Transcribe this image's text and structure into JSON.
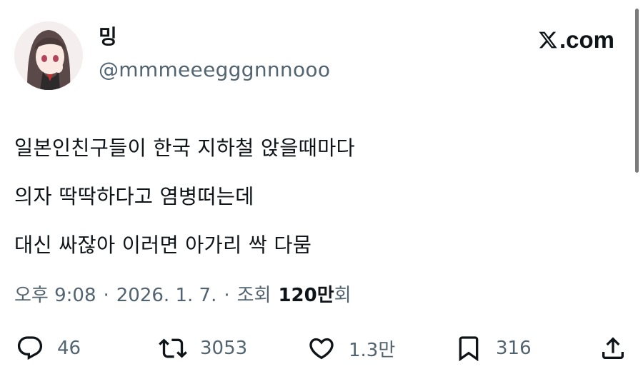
{
  "author": {
    "display_name": "밍",
    "handle": "@mmmeeegggnnnooo",
    "avatar_icon": "anime-girl-avatar"
  },
  "brand": {
    "label": ".com",
    "logo_icon": "x-logo-icon"
  },
  "tweet": {
    "lines": [
      "일본인친구들이 한국 지하철 앉을때마다",
      "의자 딱딱하다고 염병떠는데",
      "대신 싸잖아 이러면 아가리 싹 다뭄"
    ]
  },
  "meta": {
    "time": "오후 9:08",
    "sep1": "·",
    "date": "2026. 1. 7.",
    "sep2": "·",
    "views_label": "조회",
    "views_count": "120만",
    "views_unit": "회"
  },
  "actions": {
    "reply": {
      "icon": "reply-icon",
      "count": "46"
    },
    "repost": {
      "icon": "repost-icon",
      "count": "3053"
    },
    "like": {
      "icon": "heart-icon",
      "count": "1.3만"
    },
    "bookmark": {
      "icon": "bookmark-icon",
      "count": "316"
    },
    "share": {
      "icon": "share-icon"
    }
  },
  "colors": {
    "text": "#0f1419",
    "secondary": "#536471"
  }
}
